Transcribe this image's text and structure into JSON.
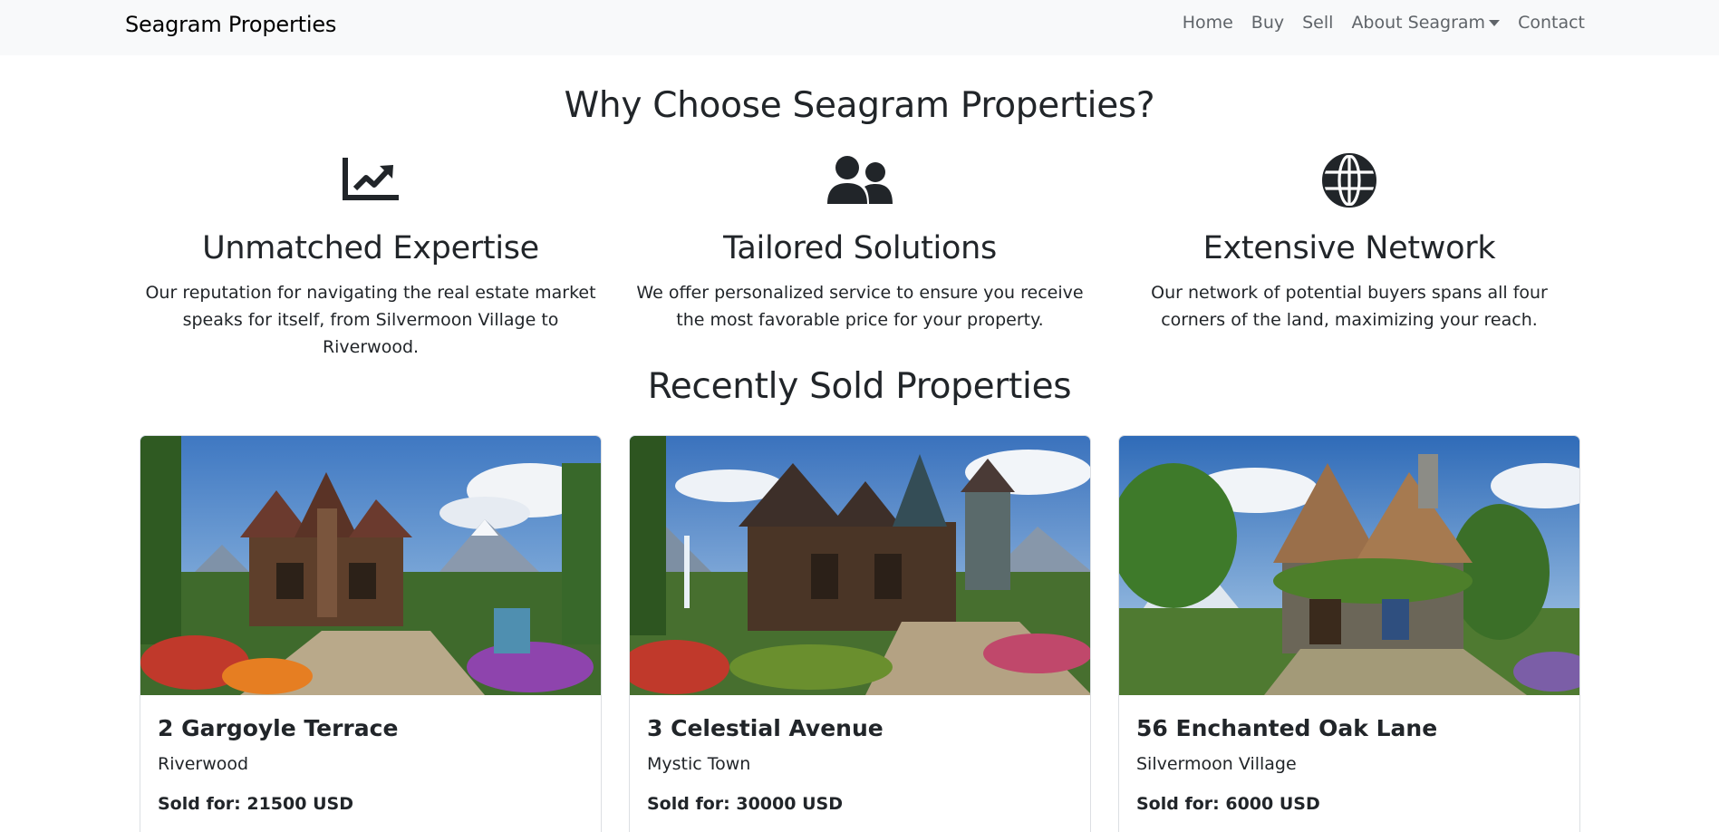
{
  "navbar": {
    "brand": "Seagram Properties",
    "links": {
      "home": "Home",
      "buy": "Buy",
      "sell": "Sell",
      "about": "About Seagram",
      "contact": "Contact"
    }
  },
  "why": {
    "title": "Why Choose Seagram Properties?",
    "features": [
      {
        "icon": "chart-line-icon",
        "title": "Unmatched Expertise",
        "text": "Our reputation for navigating the real estate market speaks for itself, from Silvermoon Village to Riverwood."
      },
      {
        "icon": "users-icon",
        "title": "Tailored Solutions",
        "text": "We offer personalized service to ensure you receive the most favorable price for your property."
      },
      {
        "icon": "globe-icon",
        "title": "Extensive Network",
        "text": "Our network of potential buyers spans all four corners of the land, maximizing your reach."
      }
    ]
  },
  "sold": {
    "title": "Recently Sold Properties",
    "properties": [
      {
        "address": "2 Gargoyle Terrace",
        "location": "Riverwood",
        "price": "Sold for: 21500 USD"
      },
      {
        "address": "3 Celestial Avenue",
        "location": "Mystic Town",
        "price": "Sold for: 30000 USD"
      },
      {
        "address": "56 Enchanted Oak Lane",
        "location": "Silvermoon Village",
        "price": "Sold for: 6000 USD"
      }
    ]
  },
  "colors": {
    "navbar_bg": "#f8f9fa",
    "text": "#212529",
    "nav_link": "#5f6469",
    "card_border": "#dcdfe3"
  }
}
